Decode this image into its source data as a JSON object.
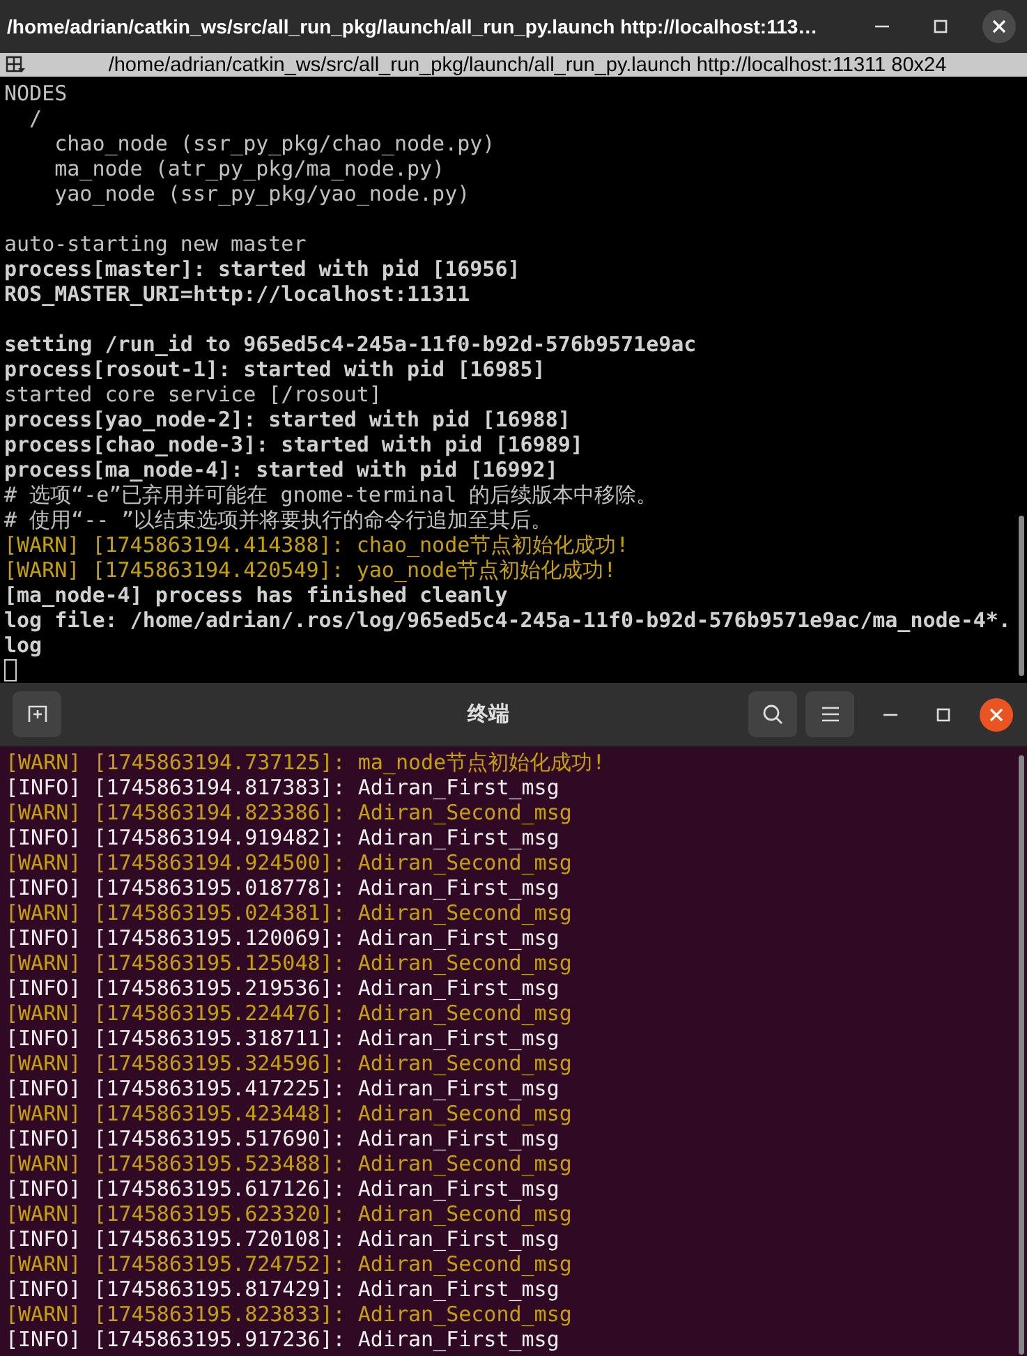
{
  "top_window": {
    "title": "/home/adrian/catkin_ws/src/all_run_pkg/launch/all_run_py.launch http://localhost:113…",
    "subtitle": "/home/adrian/catkin_ws/src/all_run_pkg/launch/all_run_py.launch http://localhost:11311 80x24",
    "lines": [
      {
        "kind": "normal",
        "text": "NODES"
      },
      {
        "kind": "normal",
        "text": "  /"
      },
      {
        "kind": "normal",
        "text": "    chao_node (ssr_py_pkg/chao_node.py)"
      },
      {
        "kind": "normal",
        "text": "    ma_node (atr_py_pkg/ma_node.py)"
      },
      {
        "kind": "normal",
        "text": "    yao_node (ssr_py_pkg/yao_node.py)"
      },
      {
        "kind": "blank"
      },
      {
        "kind": "normal",
        "text": "auto-starting new master"
      },
      {
        "kind": "bold",
        "text": "process[master]: started with pid [16956]"
      },
      {
        "kind": "bold",
        "text": "ROS_MASTER_URI=http://localhost:11311"
      },
      {
        "kind": "blank"
      },
      {
        "kind": "bold",
        "text": "setting /run_id to 965ed5c4-245a-11f0-b92d-576b9571e9ac"
      },
      {
        "kind": "bold",
        "text": "process[rosout-1]: started with pid [16985]"
      },
      {
        "kind": "normal",
        "text": "started core service [/rosout]"
      },
      {
        "kind": "bold",
        "text": "process[yao_node-2]: started with pid [16988]"
      },
      {
        "kind": "bold",
        "text": "process[chao_node-3]: started with pid [16989]"
      },
      {
        "kind": "bold",
        "text": "process[ma_node-4]: started with pid [16992]"
      },
      {
        "kind": "normal",
        "text": "# 选项“-e”已弃用并可能在 gnome-terminal 的后续版本中移除。"
      },
      {
        "kind": "normal",
        "text": "# 使用“-- ”以结束选项并将要执行的命令行追加至其后。"
      },
      {
        "kind": "warn",
        "text": "[WARN] [1745863194.414388]: chao_node节点初始化成功!"
      },
      {
        "kind": "warn",
        "text": "[WARN] [1745863194.420549]: yao_node节点初始化成功!"
      },
      {
        "kind": "bold",
        "text": "[ma_node-4] process has finished cleanly"
      },
      {
        "kind": "bold",
        "text": "log file: /home/adrian/.ros/log/965ed5c4-245a-11f0-b92d-576b9571e9ac/ma_node-4*."
      },
      {
        "kind": "bold",
        "text": "log"
      },
      {
        "kind": "cursor"
      }
    ]
  },
  "bottom_window": {
    "title": "终端",
    "lines": [
      {
        "kind": "warn",
        "text": "[WARN] [1745863194.737125]: ma_node节点初始化成功!"
      },
      {
        "kind": "info",
        "text": "[INFO] [1745863194.817383]: Adiran_First_msg"
      },
      {
        "kind": "warn",
        "text": "[WARN] [1745863194.823386]: Adiran_Second_msg"
      },
      {
        "kind": "info",
        "text": "[INFO] [1745863194.919482]: Adiran_First_msg"
      },
      {
        "kind": "warn",
        "text": "[WARN] [1745863194.924500]: Adiran_Second_msg"
      },
      {
        "kind": "info",
        "text": "[INFO] [1745863195.018778]: Adiran_First_msg"
      },
      {
        "kind": "warn",
        "text": "[WARN] [1745863195.024381]: Adiran_Second_msg"
      },
      {
        "kind": "info",
        "text": "[INFO] [1745863195.120069]: Adiran_First_msg"
      },
      {
        "kind": "warn",
        "text": "[WARN] [1745863195.125048]: Adiran_Second_msg"
      },
      {
        "kind": "info",
        "text": "[INFO] [1745863195.219536]: Adiran_First_msg"
      },
      {
        "kind": "warn",
        "text": "[WARN] [1745863195.224476]: Adiran_Second_msg"
      },
      {
        "kind": "info",
        "text": "[INFO] [1745863195.318711]: Adiran_First_msg"
      },
      {
        "kind": "warn",
        "text": "[WARN] [1745863195.324596]: Adiran_Second_msg"
      },
      {
        "kind": "info",
        "text": "[INFO] [1745863195.417225]: Adiran_First_msg"
      },
      {
        "kind": "warn",
        "text": "[WARN] [1745863195.423448]: Adiran_Second_msg"
      },
      {
        "kind": "info",
        "text": "[INFO] [1745863195.517690]: Adiran_First_msg"
      },
      {
        "kind": "warn",
        "text": "[WARN] [1745863195.523488]: Adiran_Second_msg"
      },
      {
        "kind": "info",
        "text": "[INFO] [1745863195.617126]: Adiran_First_msg"
      },
      {
        "kind": "warn",
        "text": "[WARN] [1745863195.623320]: Adiran_Second_msg"
      },
      {
        "kind": "info",
        "text": "[INFO] [1745863195.720108]: Adiran_First_msg"
      },
      {
        "kind": "warn",
        "text": "[WARN] [1745863195.724752]: Adiran_Second_msg"
      },
      {
        "kind": "info",
        "text": "[INFO] [1745863195.817429]: Adiran_First_msg"
      },
      {
        "kind": "warn",
        "text": "[WARN] [1745863195.823833]: Adiran_Second_msg"
      },
      {
        "kind": "info",
        "text": "[INFO] [1745863195.917236]: Adiran_First_msg"
      }
    ]
  }
}
